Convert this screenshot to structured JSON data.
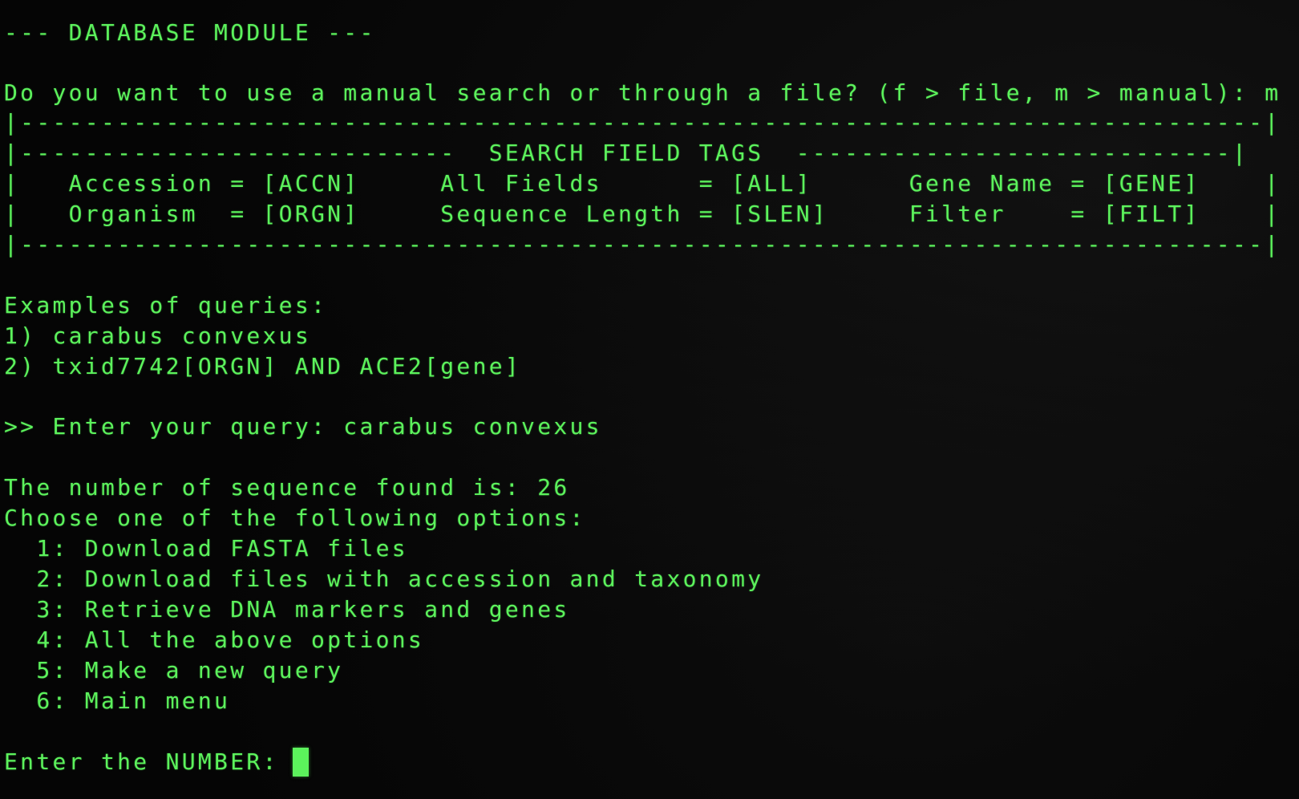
{
  "module_header": "--- DATABASE MODULE ---",
  "search_mode_prompt": "Do you want to use a manual search or through a file? (f > file, m > manual): m",
  "tags_table": {
    "border_top": "|-----------------------------------------------------------------------------|",
    "title_row": "|---------------------------  SEARCH FIELD TAGS  ---------------------------|",
    "row_1": "|   Accession = [ACCN]     All Fields      = [ALL]      Gene Name = [GENE]    |",
    "row_2": "|   Organism  = [ORGN]     Sequence Length = [SLEN]     Filter    = [FILT]    |",
    "border_bottom": "|-----------------------------------------------------------------------------|"
  },
  "examples": {
    "heading": "Examples of queries:",
    "items": [
      "1) carabus convexus",
      "2) txid7742[ORGN] AND ACE2[gene]"
    ]
  },
  "query_prompt": ">> Enter your query: carabus convexus",
  "result_text": "The number of sequence found is: 26",
  "options_heading": "Choose one of the following options:",
  "options": [
    "  1: Download FASTA files",
    "  2: Download files with accession and taxonomy",
    "  3: Retrieve DNA markers and genes",
    "  4: All the above options",
    "  5: Make a new query",
    "  6: Main menu"
  ],
  "number_prompt": "Enter the NUMBER: ",
  "colors": {
    "text": "#5cf25c",
    "background": "#050505"
  }
}
